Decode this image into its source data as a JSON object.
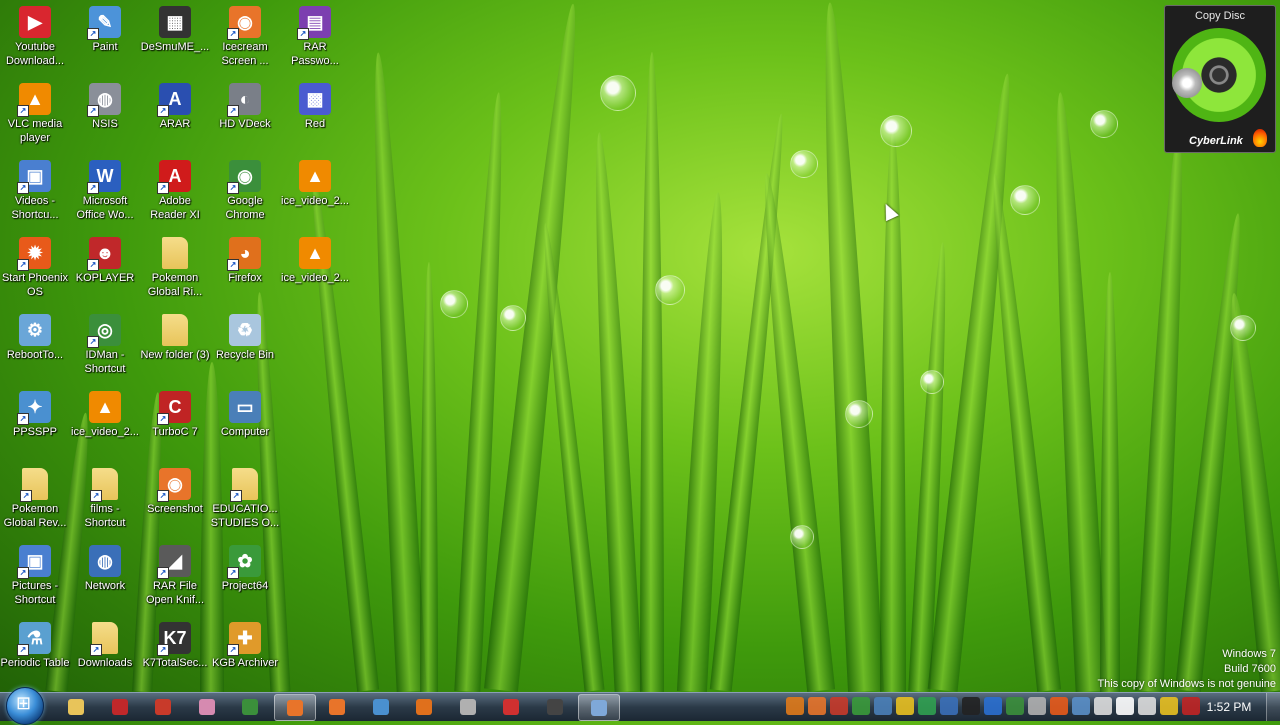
{
  "desktop": {
    "icons": [
      {
        "label": "Youtube Download...",
        "icon": "youtube-downloader-icon",
        "color": "#d9262f",
        "glyph": "▶",
        "shortcut": false
      },
      {
        "label": "Paint",
        "icon": "paint-icon",
        "color": "#4c93d9",
        "glyph": "✎",
        "shortcut": true
      },
      {
        "label": "DeSmuME_...",
        "icon": "desmume-icon",
        "color": "#333333",
        "glyph": "▦",
        "shortcut": false
      },
      {
        "label": "Icecream Screen ...",
        "icon": "icecream-screen-icon",
        "color": "#e8742a",
        "glyph": "◉",
        "shortcut": true
      },
      {
        "label": "RAR Passwo...",
        "icon": "rar-password-icon",
        "color": "#7c3fb0",
        "glyph": "▤",
        "shortcut": true
      },
      {
        "label": "VLC media player",
        "icon": "vlc-icon",
        "color": "#f08a00",
        "glyph": "▲",
        "shortcut": true
      },
      {
        "label": "NSIS",
        "icon": "nsis-icon",
        "color": "#8a8f99",
        "glyph": "◍",
        "shortcut": true
      },
      {
        "label": "ARAR",
        "icon": "arar-icon",
        "color": "#2a4fb0",
        "glyph": "A",
        "shortcut": true
      },
      {
        "label": "HD VDeck",
        "icon": "hd-vdeck-icon",
        "color": "#7a7f88",
        "glyph": "◐",
        "shortcut": true
      },
      {
        "label": "Red",
        "icon": "red-icon",
        "color": "#4a5bd0",
        "glyph": "▩",
        "shortcut": false
      },
      {
        "label": "Videos - Shortcu...",
        "icon": "videos-shortcut-icon",
        "color": "#4a7fd0",
        "glyph": "▣",
        "shortcut": true
      },
      {
        "label": "Microsoft Office Wo...",
        "icon": "word-icon",
        "color": "#2b5fbf",
        "glyph": "W",
        "shortcut": true
      },
      {
        "label": "Adobe Reader XI",
        "icon": "adobe-reader-icon",
        "color": "#d01b1b",
        "glyph": "A",
        "shortcut": true
      },
      {
        "label": "Google Chrome",
        "icon": "chrome-icon",
        "color": "#3b8f3b",
        "glyph": "◉",
        "shortcut": true
      },
      {
        "label": "ice_video_2...",
        "icon": "vlc-file-icon",
        "color": "#f08a00",
        "glyph": "▲",
        "shortcut": false
      },
      {
        "label": "Start Phoenix OS",
        "icon": "phoenix-os-icon",
        "color": "#e85a1a",
        "glyph": "✹",
        "shortcut": true
      },
      {
        "label": "KOPLAYER",
        "icon": "koplayer-icon",
        "color": "#c0282a",
        "glyph": "☻",
        "shortcut": true
      },
      {
        "label": "Pokemon Global Ri...",
        "icon": "folder-icon",
        "color": "#e8c45a",
        "glyph": "",
        "shortcut": false
      },
      {
        "label": "Firefox",
        "icon": "firefox-icon",
        "color": "#e0701c",
        "glyph": "◕",
        "shortcut": true
      },
      {
        "label": "ice_video_2...",
        "icon": "vlc-file-icon",
        "color": "#f08a00",
        "glyph": "▲",
        "shortcut": false
      },
      {
        "label": "RebootTo...",
        "icon": "reboot-icon",
        "color": "#6aa6d8",
        "glyph": "⚙",
        "shortcut": false
      },
      {
        "label": "IDMan - Shortcut",
        "icon": "idm-icon",
        "color": "#3b8f3b",
        "glyph": "◎",
        "shortcut": true
      },
      {
        "label": "New folder (3)",
        "icon": "folder-icon",
        "color": "#e8c45a",
        "glyph": "",
        "shortcut": false
      },
      {
        "label": "Recycle Bin",
        "icon": "recycle-bin-icon",
        "color": "#a9c6de",
        "glyph": "♻",
        "shortcut": false
      },
      {
        "label": "",
        "icon": "",
        "color": "",
        "glyph": "",
        "shortcut": false
      },
      {
        "label": "PPSSPP",
        "icon": "ppsspp-icon",
        "color": "#4a90d0",
        "glyph": "✦",
        "shortcut": true
      },
      {
        "label": "ice_video_2...",
        "icon": "vlc-file-icon",
        "color": "#f08a00",
        "glyph": "▲",
        "shortcut": false
      },
      {
        "label": "TurboC 7",
        "icon": "turboc-icon",
        "color": "#c02424",
        "glyph": "C",
        "shortcut": true
      },
      {
        "label": "Computer",
        "icon": "computer-icon",
        "color": "#4a7fb8",
        "glyph": "▭",
        "shortcut": false
      },
      {
        "label": "",
        "icon": "",
        "color": "",
        "glyph": "",
        "shortcut": false
      },
      {
        "label": "Pokemon Global Rev...",
        "icon": "folder-shortcut-icon",
        "color": "#e8c45a",
        "glyph": "",
        "shortcut": true
      },
      {
        "label": "films - Shortcut",
        "icon": "folder-shortcut-icon",
        "color": "#e8c45a",
        "glyph": "",
        "shortcut": true
      },
      {
        "label": "Screenshot",
        "icon": "screenshot-icon",
        "color": "#e8742a",
        "glyph": "◉",
        "shortcut": true
      },
      {
        "label": "EDUCATIO... STUDIES O...",
        "icon": "folder-shortcut-icon",
        "color": "#e8c45a",
        "glyph": "",
        "shortcut": true
      },
      {
        "label": "",
        "icon": "",
        "color": "",
        "glyph": "",
        "shortcut": false
      },
      {
        "label": "Pictures - Shortcut",
        "icon": "pictures-shortcut-icon",
        "color": "#4a7fd0",
        "glyph": "▣",
        "shortcut": true
      },
      {
        "label": "Network",
        "icon": "network-icon",
        "color": "#3a6fb8",
        "glyph": "◍",
        "shortcut": false
      },
      {
        "label": "RAR File Open Knif...",
        "icon": "rar-knife-icon",
        "color": "#5a5a5a",
        "glyph": "◢",
        "shortcut": true
      },
      {
        "label": "Project64",
        "icon": "project64-icon",
        "color": "#3a9a3a",
        "glyph": "✿",
        "shortcut": true
      },
      {
        "label": "",
        "icon": "",
        "color": "",
        "glyph": "",
        "shortcut": false
      },
      {
        "label": "Periodic Table",
        "icon": "periodic-table-icon",
        "color": "#5aa0d0",
        "glyph": "⚗",
        "shortcut": true
      },
      {
        "label": "Downloads",
        "icon": "downloads-folder-icon",
        "color": "#e8c45a",
        "glyph": "",
        "shortcut": true
      },
      {
        "label": "K7TotalSec...",
        "icon": "k7-icon",
        "color": "#333333",
        "glyph": "K7",
        "shortcut": true
      },
      {
        "label": "KGB Archiver",
        "icon": "kgb-archiver-icon",
        "color": "#e09a2a",
        "glyph": "✚",
        "shortcut": true
      },
      {
        "label": "",
        "icon": "",
        "color": "",
        "glyph": "",
        "shortcut": false
      }
    ]
  },
  "gadget": {
    "title": "Copy Disc",
    "brand": "CyberLink"
  },
  "watermark": {
    "line1": "Windows 7",
    "line2": "Build 7600",
    "line3": "This copy of Windows is not genuine"
  },
  "taskbar": {
    "items": [
      {
        "icon": "explorer-icon",
        "color": "#e8c45a",
        "active": false
      },
      {
        "icon": "koplayer-task-icon",
        "color": "#c0282a",
        "active": false
      },
      {
        "icon": "app-task-icon",
        "color": "#c83a2a",
        "active": false
      },
      {
        "icon": "paint-task-icon",
        "color": "#d68ab0",
        "active": false
      },
      {
        "icon": "chrome-task-icon",
        "color": "#3b8f3b",
        "active": false
      },
      {
        "icon": "icecream-task-icon",
        "color": "#e8742a",
        "active": true
      },
      {
        "icon": "screenshot-task-icon",
        "color": "#e8742a",
        "active": false
      },
      {
        "icon": "ppsspp-task-icon",
        "color": "#4a90d0",
        "active": false
      },
      {
        "icon": "firefox-task-icon",
        "color": "#e0701c",
        "active": false
      },
      {
        "icon": "disc-task-icon",
        "color": "#b0b0b0",
        "active": false
      },
      {
        "icon": "media-task-icon",
        "color": "#d03030",
        "active": false
      },
      {
        "icon": "k7-task-icon",
        "color": "#444444",
        "active": false
      },
      {
        "icon": "window-task-icon",
        "color": "#7fa8d8",
        "active": true
      }
    ],
    "tray": [
      {
        "icon": "tray-arrows-icon",
        "color": "#e07a1a"
      },
      {
        "icon": "tray-icecream-icon",
        "color": "#e8742a"
      },
      {
        "icon": "tray-app-icon",
        "color": "#c83a2a"
      },
      {
        "icon": "tray-green-icon",
        "color": "#3a9a3a"
      },
      {
        "icon": "tray-monitor-icon",
        "color": "#4a7fb8"
      },
      {
        "icon": "tray-warning-icon",
        "color": "#e8c020"
      },
      {
        "icon": "tray-refresh-icon",
        "color": "#30a050"
      },
      {
        "icon": "tray-dots-icon",
        "color": "#3a6fb8"
      },
      {
        "icon": "tray-m-icon",
        "color": "#222222"
      },
      {
        "icon": "tray-bluetooth-icon",
        "color": "#2a6fd0"
      },
      {
        "icon": "tray-chrome-icon",
        "color": "#3b8f3b"
      },
      {
        "icon": "tray-disc-icon",
        "color": "#b0b0b0"
      },
      {
        "icon": "tray-flame-icon",
        "color": "#e85a1a"
      },
      {
        "icon": "tray-network-icon",
        "color": "#5a8fc8"
      },
      {
        "icon": "tray-grid-icon",
        "color": "#dddddd"
      },
      {
        "icon": "tray-flag-icon",
        "color": "#ffffff"
      },
      {
        "icon": "tray-volume-icon",
        "color": "#dddddd"
      },
      {
        "icon": "tray-charge-icon",
        "color": "#e8c020"
      },
      {
        "icon": "tray-k7-icon",
        "color": "#c02424"
      }
    ],
    "clock": "1:52 PM"
  }
}
